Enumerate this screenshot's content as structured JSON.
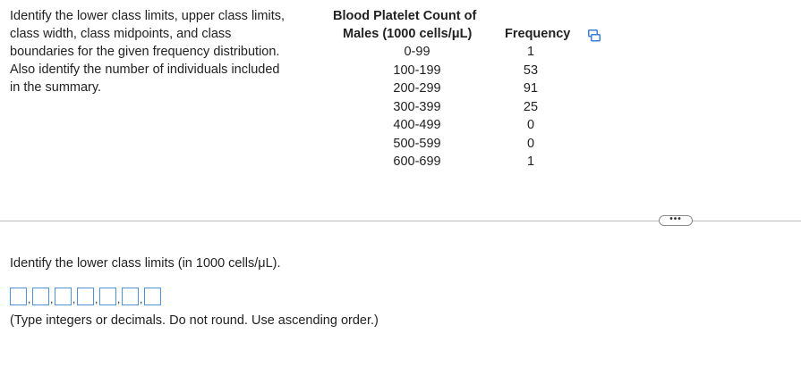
{
  "question": {
    "lines": [
      "Identify the lower class limits, upper class limits,",
      "class width, class midpoints, and class",
      "boundaries for the given frequency distribution.",
      "Also identify the number of individuals included",
      "in the summary."
    ]
  },
  "table": {
    "title": "Blood Platelet Count of",
    "class_header": "Males (1000 cells/μL)",
    "frequency_header": "Frequency",
    "copy_icon": "copy-icon",
    "rows": [
      {
        "class": "0-99",
        "frequency": "1"
      },
      {
        "class": "100-199",
        "frequency": "53"
      },
      {
        "class": "200-299",
        "frequency": "91"
      },
      {
        "class": "300-399",
        "frequency": "25"
      },
      {
        "class": "400-499",
        "frequency": "0"
      },
      {
        "class": "500-599",
        "frequency": "0"
      },
      {
        "class": "600-699",
        "frequency": "1"
      }
    ]
  },
  "more_button": {
    "label": "•••"
  },
  "prompt": "Identify the lower class limits (in 1000 cells/μL).",
  "answer_boxes": [
    {
      "value": ""
    },
    {
      "value": ""
    },
    {
      "value": ""
    },
    {
      "value": ""
    },
    {
      "value": ""
    },
    {
      "value": ""
    },
    {
      "value": ""
    }
  ],
  "separator": ",",
  "hint": "(Type integers or decimals. Do not round. Use ascending order.)"
}
